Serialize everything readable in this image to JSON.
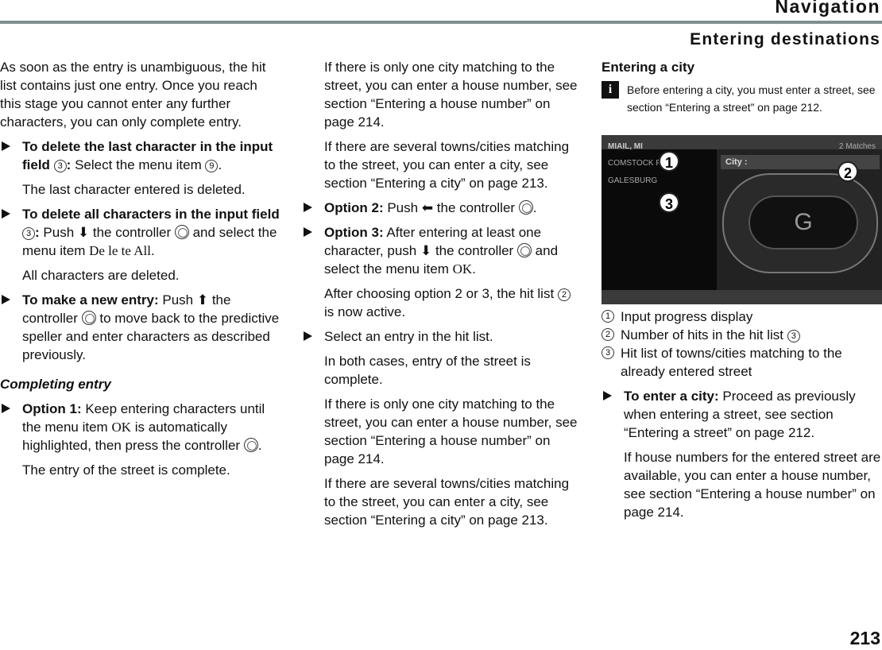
{
  "header": {
    "chapter": "Navigation",
    "section": "Entering destinations"
  },
  "col1": {
    "intro": "As soon as the entry is unambiguous, the hit list contains just one entry. Once you reach this stage you cannot enter any further characters, you can only complete entry.",
    "s1_bold": "To delete the last character in the input field ",
    "s1_n1": "3",
    "s1_colon": ":",
    "s1_text": " Select the menu item ",
    "s1_n2": "9",
    "s1_end": ".",
    "s1_result": "The last character entered is deleted.",
    "s2_bold": "To delete all characters in the input field ",
    "s2_n1": "3",
    "s2_colon": ":",
    "s2_text1": " Push ",
    "s2_arrow": "⬇",
    "s2_text2": " the controller ",
    "s2_text3": " and select the menu item ",
    "s2_item": "De le te  All",
    ".": ".",
    "s2_end": ".",
    "s2_result": "All characters are deleted.",
    "s3_bold": "To make a new entry:",
    "s3_text1": " Push ",
    "s3_arrow": "⬆",
    "s3_text2": " the controller ",
    "s3_text3": " to move back to the predictive speller and enter characters as described previously.",
    "heading": "Completing entry",
    "o1_bold": "Option 1:",
    "o1_text1": " Keep entering characters until the menu item ",
    "o1_item": "OK",
    "o1_text2": " is automatically highlighted, then press the controller ",
    "o1_end": ".",
    "o1_result": "The entry of the street is complete."
  },
  "col2": {
    "p1": "If there is only one city matching to the street, you can enter a house number, see section “Entering a house number” on page 214.",
    "p2": "If there are several towns/cities matching to the street, you can enter a city, see section “Entering a city” on page 213.",
    "o2_bold": "Option 2:",
    "o2_text1": " Push ",
    "o2_arrow": "⬅",
    "o2_text2": " the controller ",
    "o2_end": ".",
    "o3_bold": "Option 3:",
    "o3_text1": " After entering at least one character, push ",
    "o3_arrow": "⬇",
    "o3_text2": " the controller ",
    "o3_text3": " and select the menu item ",
    "o3_item": "OK",
    "o3_end": ".",
    "after1": "After choosing option 2 or 3, the hit list ",
    "after_n": "2",
    "after2": " is now active.",
    "select": "Select an entry in the hit list.",
    "both": "In both cases, entry of the street is complete.",
    "p3": "If there is only one city matching to the street, you can enter a house number, see section “Entering a house number” on page 214.",
    "p4": "If there are several towns/cities matching to the street, you can enter a city, see section “Entering a city” on page 213."
  },
  "col3": {
    "heading": "Entering a city",
    "info_icon": "i",
    "note": "Before entering a city, you must enter a street, see section “Entering a street” on page 212.",
    "screen": {
      "input": "MIAIL, MI",
      "matches": "2 Matches",
      "hits": [
        "COMSTOCK PARK",
        "GALESBURG"
      ],
      "field": "City :",
      "center": "G",
      "callouts": [
        "1",
        "2",
        "3"
      ]
    },
    "legend": [
      {
        "n": "1",
        "text": "Input progress display"
      },
      {
        "n": "2",
        "text": "Number of hits in the hit list ",
        "ref": "3"
      },
      {
        "n": "3",
        "text": "Hit list of towns/cities matching to the already entered street"
      }
    ],
    "s_bold": "To enter a city:",
    "s_text": " Proceed as previously when entering a street, see section “Entering a street” on page 212.",
    "house": "If house numbers for the entered street are available, you can enter a house number, see section “Entering a house number” on page 214."
  },
  "page_number": "213"
}
